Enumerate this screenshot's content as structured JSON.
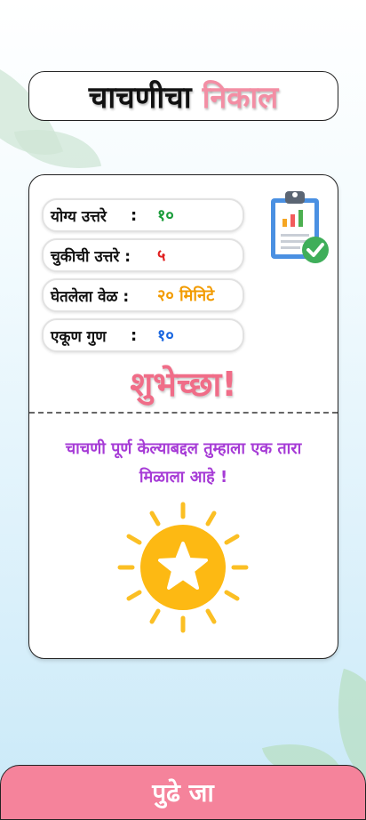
{
  "header": {
    "title_part1": "चाचणीचा",
    "title_part2": "निकाल"
  },
  "results": [
    {
      "label": "योग्य उत्तरे",
      "sep": ":",
      "value": "१०",
      "color": "#1a9c3a"
    },
    {
      "label": "चुकीची उत्तरे :",
      "sep": "",
      "value": "५",
      "color": "#e02020"
    },
    {
      "label": "घेतलेला वेळ :",
      "sep": "",
      "value": "२० मिनिटे",
      "color": "#f29b00"
    },
    {
      "label": "एकूण गुण",
      "sep": ":",
      "value": "१०",
      "color": "#1966e0"
    }
  ],
  "congrats": "शुभेच्छा!",
  "message_line1": "चाचणी पूर्ण केल्याबद्दल तुम्हाला एक तारा",
  "message_line2": "मिळाला आहे !",
  "icons": [
    "clipboard-check-icon",
    "sun-star-icon"
  ],
  "next_button": "पुढे जा",
  "colors": {
    "accent": "#f5839b",
    "title_pink": "#f38ea4",
    "message_purple": "#a63bd6"
  }
}
